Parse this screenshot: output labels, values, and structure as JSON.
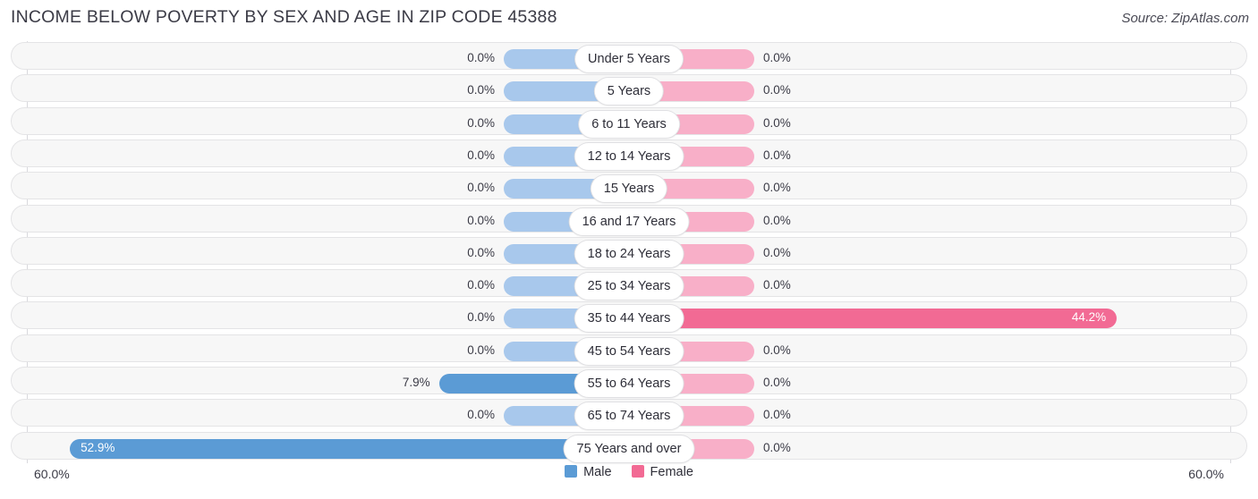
{
  "header": {
    "title": "INCOME BELOW POVERTY BY SEX AND AGE IN ZIP CODE 45388",
    "source": "Source: ZipAtlas.com"
  },
  "legend": {
    "male_label": "Male",
    "female_label": "Female",
    "male_color": "#5b9bd5",
    "female_color": "#f26a94"
  },
  "axis": {
    "left_label": "60.0%",
    "right_label": "60.0%",
    "max": 60.0
  },
  "chart_data": {
    "type": "bar",
    "title": "INCOME BELOW POVERTY BY SEX AND AGE IN ZIP CODE 45388",
    "subtitle": "Source: ZipAtlas.com",
    "orientation": "horizontal-diverging",
    "xlabel": "",
    "ylabel": "",
    "xlim": [
      60.0,
      60.0
    ],
    "grid": true,
    "legend_position": "bottom-center",
    "categories": [
      "Under 5 Years",
      "5 Years",
      "6 to 11 Years",
      "12 to 14 Years",
      "15 Years",
      "16 and 17 Years",
      "18 to 24 Years",
      "25 to 34 Years",
      "35 to 44 Years",
      "45 to 54 Years",
      "55 to 64 Years",
      "65 to 74 Years",
      "75 Years and over"
    ],
    "series": [
      {
        "name": "Male",
        "side": "left",
        "color": "#5b9bd5",
        "values": [
          0.0,
          0.0,
          0.0,
          0.0,
          0.0,
          0.0,
          0.0,
          0.0,
          0.0,
          0.0,
          7.9,
          0.0,
          52.9
        ],
        "labels": [
          "0.0%",
          "0.0%",
          "0.0%",
          "0.0%",
          "0.0%",
          "0.0%",
          "0.0%",
          "0.0%",
          "0.0%",
          "0.0%",
          "7.9%",
          "0.0%",
          "52.9%"
        ]
      },
      {
        "name": "Female",
        "side": "right",
        "color": "#f26a94",
        "values": [
          0.0,
          0.0,
          0.0,
          0.0,
          0.0,
          0.0,
          0.0,
          0.0,
          44.2,
          0.0,
          0.0,
          0.0,
          0.0
        ],
        "labels": [
          "0.0%",
          "0.0%",
          "0.0%",
          "0.0%",
          "0.0%",
          "0.0%",
          "0.0%",
          "0.0%",
          "44.2%",
          "0.0%",
          "0.0%",
          "0.0%",
          "0.0%"
        ]
      }
    ]
  }
}
